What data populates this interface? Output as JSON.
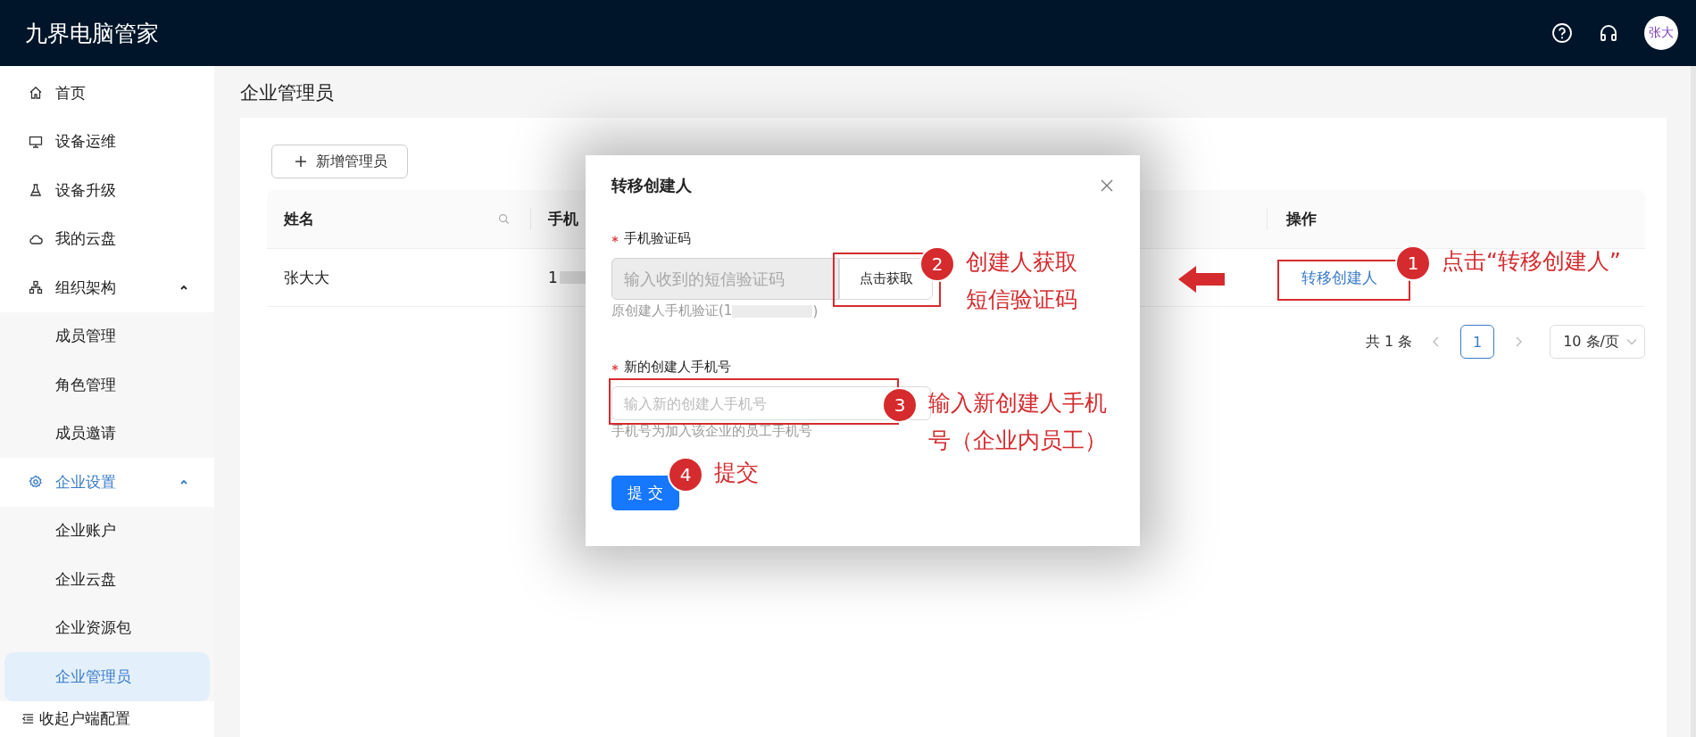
{
  "app": {
    "title": "九界电脑管家",
    "avatar": "张大"
  },
  "sidebar": {
    "items": [
      {
        "kind": "link",
        "label": "首页",
        "active": false
      },
      {
        "kind": "link",
        "label": "设备运维",
        "active": false
      },
      {
        "kind": "link",
        "label": "设备升级",
        "active": false
      },
      {
        "kind": "link",
        "label": "我的云盘",
        "active": false
      },
      {
        "kind": "group",
        "label": "组织架构",
        "active": false,
        "expanded": true,
        "children": [
          {
            "label": "成员管理",
            "selected": false
          },
          {
            "label": "角色管理",
            "selected": false
          },
          {
            "label": "成员邀请",
            "selected": false
          }
        ]
      },
      {
        "kind": "group",
        "label": "企业设置",
        "active": true,
        "expanded": true,
        "children": [
          {
            "label": "企业账户",
            "selected": false
          },
          {
            "label": "企业云盘",
            "selected": false
          },
          {
            "label": "企业资源包",
            "selected": false
          },
          {
            "label": "企业管理员",
            "selected": true
          }
        ]
      }
    ],
    "footer": "收起户端配置"
  },
  "page": {
    "title": "企业管理员",
    "add_button": "新增管理员"
  },
  "table": {
    "columns": [
      {
        "label": "姓名",
        "searchable": true
      },
      {
        "label": "手机"
      },
      {
        "label": "操作"
      }
    ],
    "rows": [
      {
        "name": "张大大",
        "phone": "1",
        "action": "转移创建人"
      }
    ]
  },
  "pagination": {
    "total": "共 1 条",
    "pages": [
      {
        "label": "1",
        "selected": true
      }
    ],
    "page_size": "10 条/页"
  },
  "dialog": {
    "title": "转移创建人",
    "fields": [
      {
        "label": "手机验证码",
        "required": true,
        "placeholder": "输入收到的短信验证码",
        "disabled": true,
        "button": "点击获取",
        "hint": "原创建人手机验证(1",
        "hint_end": ")"
      },
      {
        "label": "新的创建人手机号",
        "required": true,
        "placeholder": "输入新的创建人手机号",
        "disabled": false,
        "hint": "手机号为加入该企业的员工手机号"
      }
    ],
    "submit": "提 交"
  },
  "annotations": [
    {
      "number": "2",
      "lines": [
        "创建人获取",
        "短信验证码"
      ]
    },
    {
      "number": "1",
      "lines": [
        "点击“转移创建人”"
      ]
    },
    {
      "number": "3",
      "lines": [
        "输入新创建人手机",
        "号（企业内员工）"
      ]
    },
    {
      "number": "4",
      "lines": [
        "提交"
      ]
    }
  ]
}
